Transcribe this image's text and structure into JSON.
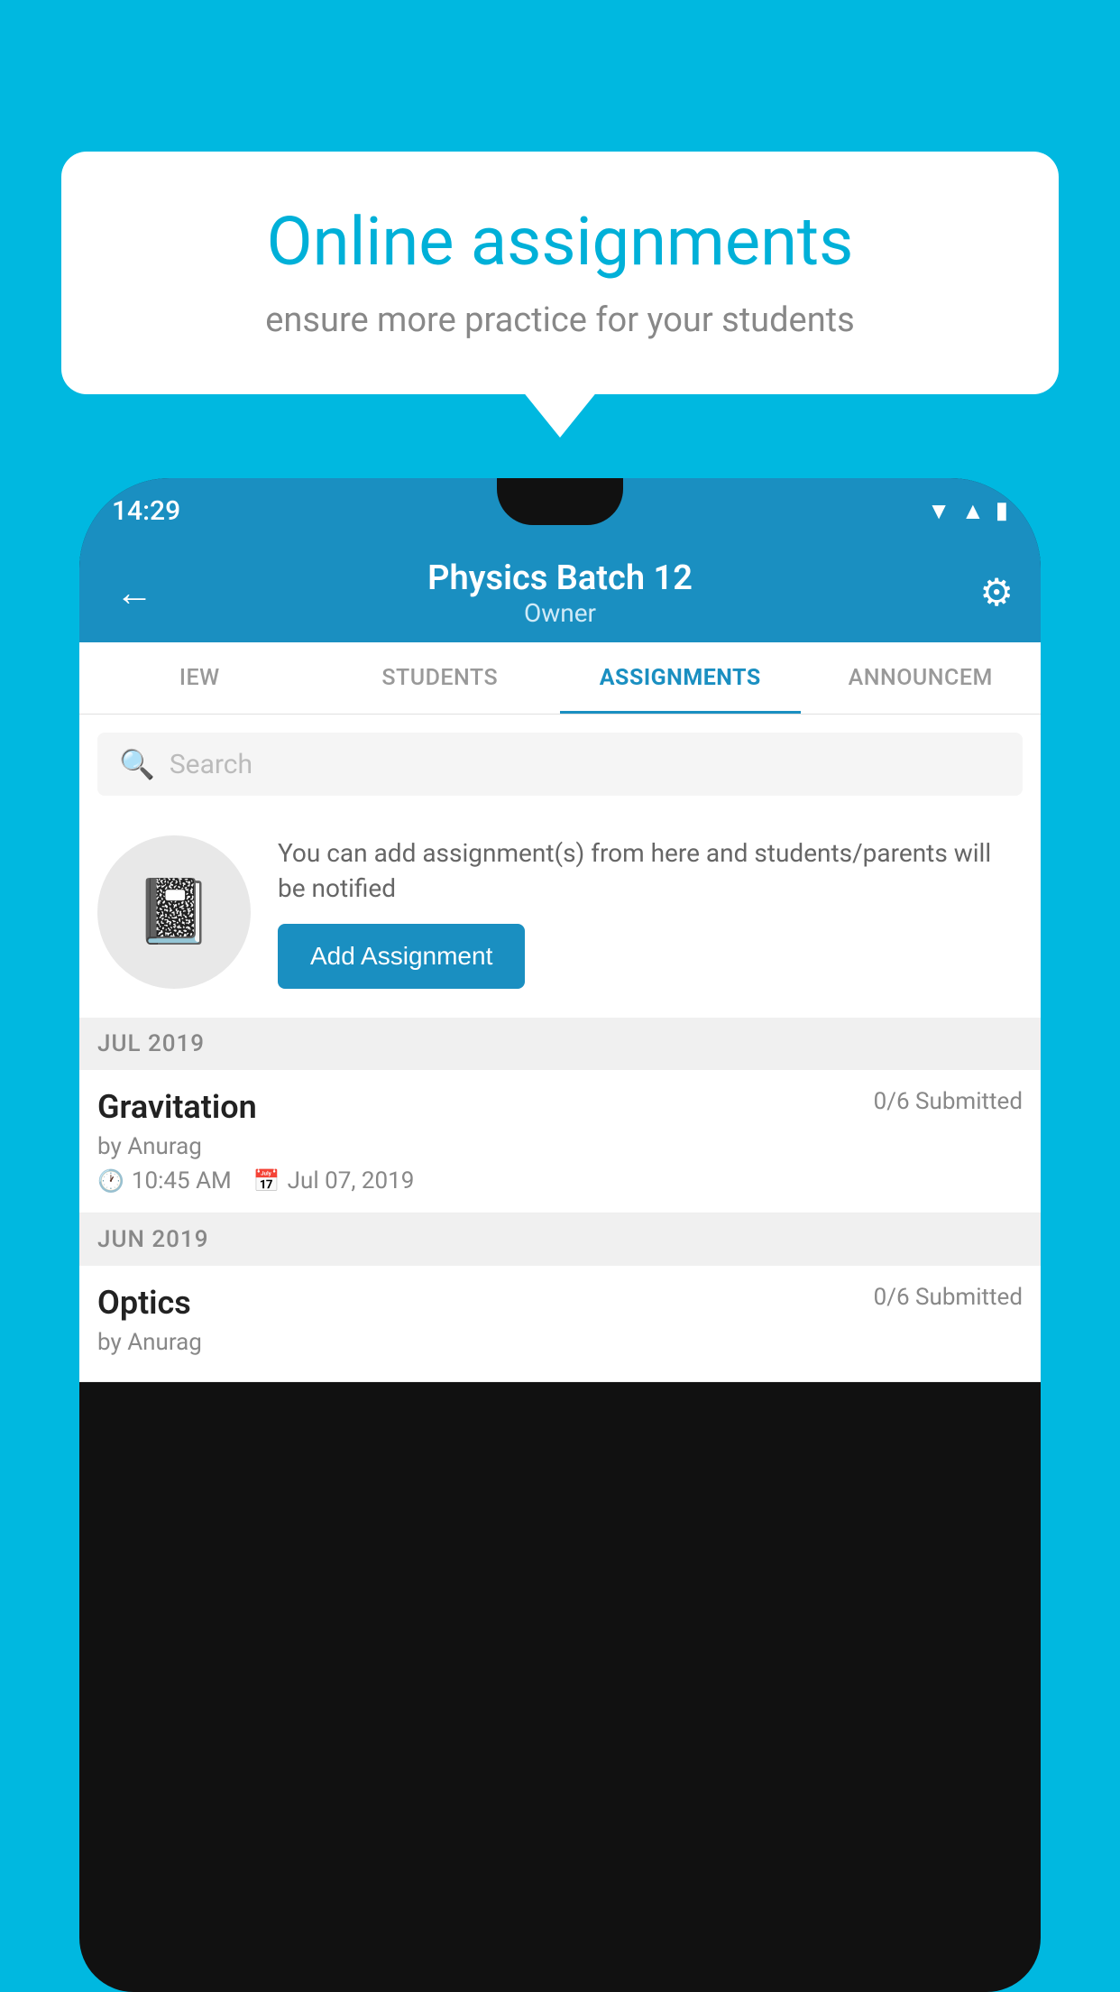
{
  "bubble": {
    "title": "Online assignments",
    "subtitle": "ensure more practice for your students"
  },
  "phone": {
    "status_bar": {
      "time": "14:29",
      "icons": [
        "wifi",
        "signal",
        "battery"
      ]
    },
    "app_bar": {
      "title": "Physics Batch 12",
      "subtitle": "Owner",
      "back_label": "←",
      "gear_label": "⚙"
    },
    "tabs": [
      {
        "label": "IEW",
        "active": false
      },
      {
        "label": "STUDENTS",
        "active": false
      },
      {
        "label": "ASSIGNMENTS",
        "active": true
      },
      {
        "label": "ANNOUNCEM",
        "active": false
      }
    ],
    "search": {
      "placeholder": "Search"
    },
    "empty_state": {
      "description": "You can add assignment(s) from here and students/parents will be notified",
      "button_label": "Add Assignment"
    },
    "sections": [
      {
        "header": "JUL 2019",
        "assignments": [
          {
            "title": "Gravitation",
            "submitted": "0/6 Submitted",
            "by": "by Anurag",
            "time": "10:45 AM",
            "date": "Jul 07, 2019"
          }
        ]
      },
      {
        "header": "JUN 2019",
        "assignments": [
          {
            "title": "Optics",
            "submitted": "0/6 Submitted",
            "by": "by Anurag",
            "time": "",
            "date": ""
          }
        ]
      }
    ]
  },
  "colors": {
    "primary": "#1a8fc1",
    "background": "#00b8e0",
    "white": "#ffffff"
  }
}
